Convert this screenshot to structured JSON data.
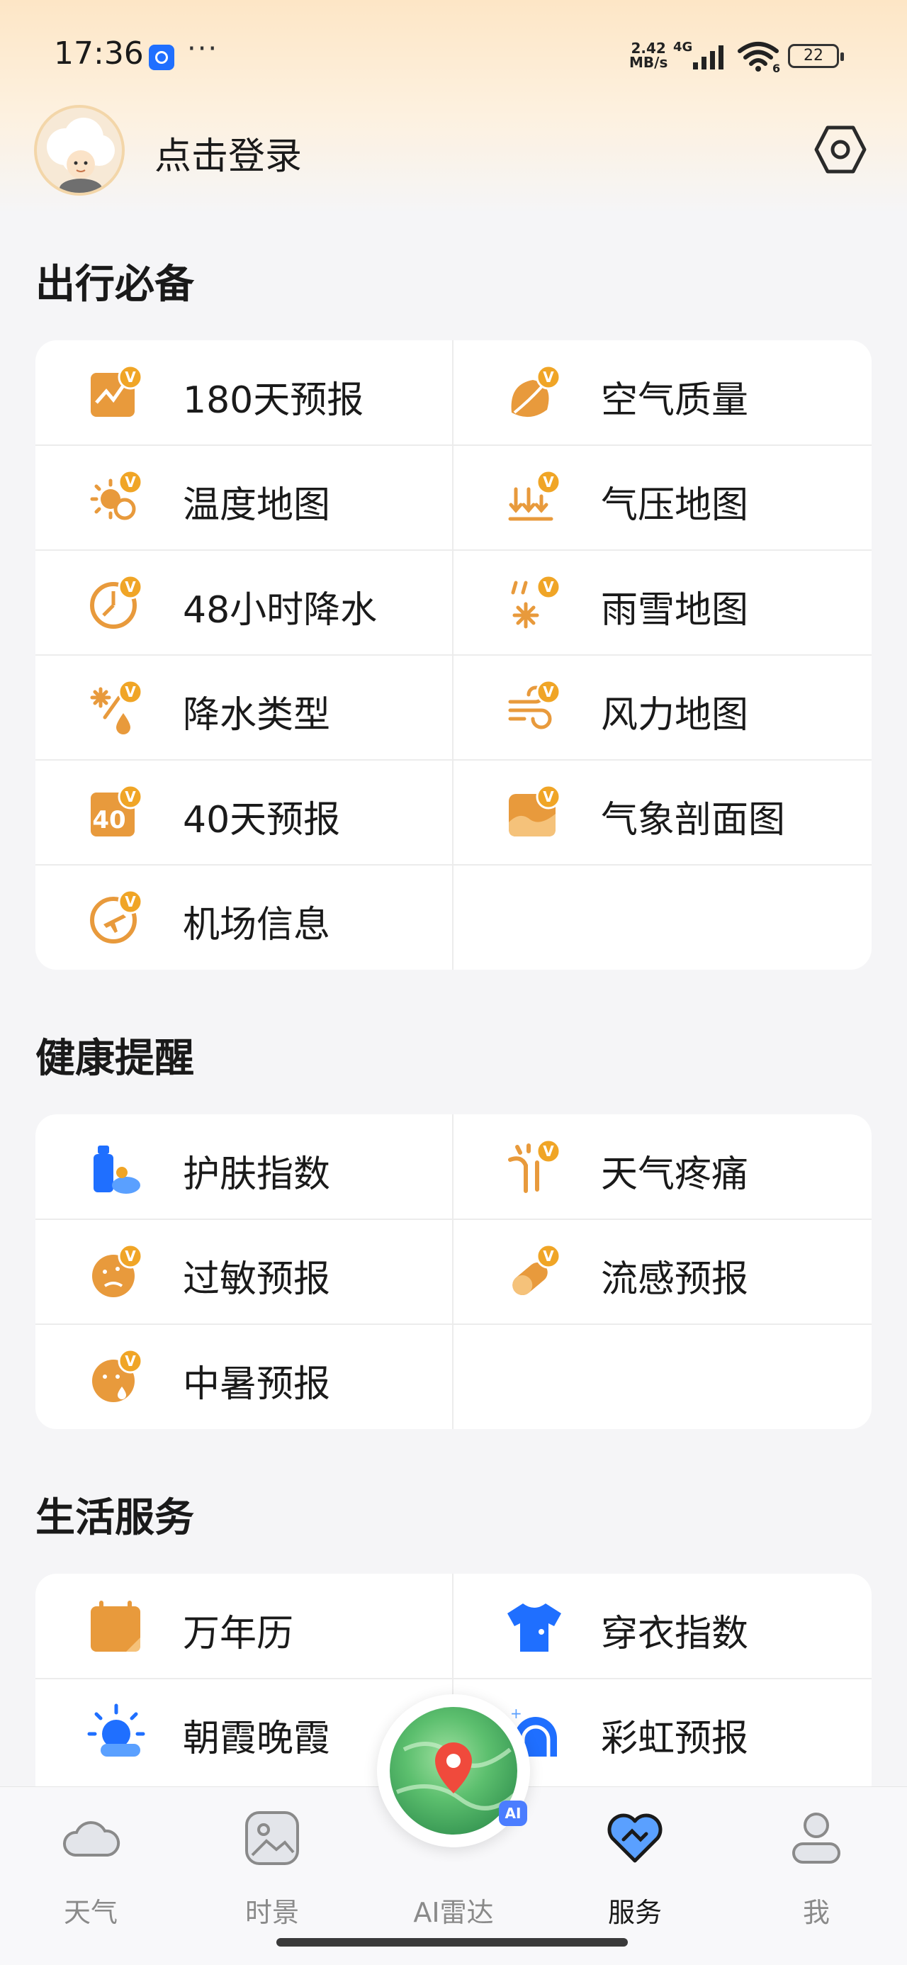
{
  "status_bar": {
    "time": "17:36",
    "speed_value": "2.42",
    "speed_unit": "MB/s",
    "network": "4G",
    "wifi_badge": "6",
    "battery": "22"
  },
  "header": {
    "login_text": "点击登录",
    "avatar_icon": "cloud-character-avatar",
    "settings_icon": "hexagon-gear-icon"
  },
  "sections": {
    "travel": {
      "title": "出行必备",
      "items": [
        {
          "label": "180天预报",
          "icon": "calendar-180-icon"
        },
        {
          "label": "空气质量",
          "icon": "leaf-icon"
        },
        {
          "label": "温度地图",
          "icon": "thermo-sun-icon"
        },
        {
          "label": "气压地图",
          "icon": "pressure-arrows-icon"
        },
        {
          "label": "48小时降水",
          "icon": "clock-rain-icon"
        },
        {
          "label": "雨雪地图",
          "icon": "rain-snow-icon"
        },
        {
          "label": "降水类型",
          "icon": "precip-type-icon"
        },
        {
          "label": "风力地图",
          "icon": "wind-icon"
        },
        {
          "label": "40天预报",
          "icon": "calendar-40-icon"
        },
        {
          "label": "气象剖面图",
          "icon": "profile-chart-icon"
        },
        {
          "label": "机场信息",
          "icon": "airplane-icon"
        }
      ]
    },
    "health": {
      "title": "健康提醒",
      "items": [
        {
          "label": "护肤指数",
          "icon": "skincare-icon"
        },
        {
          "label": "天气疼痛",
          "icon": "pain-joint-icon"
        },
        {
          "label": "过敏预报",
          "icon": "allergy-icon"
        },
        {
          "label": "流感预报",
          "icon": "pill-icon"
        },
        {
          "label": "中暑预报",
          "icon": "heatstroke-icon"
        }
      ]
    },
    "life": {
      "title": "生活服务",
      "items": [
        {
          "label": "万年历",
          "icon": "calendar-icon"
        },
        {
          "label": "穿衣指数",
          "icon": "tshirt-icon"
        },
        {
          "label": "朝霞晚霞",
          "icon": "sunrise-icon"
        },
        {
          "label": "彩虹预报",
          "icon": "rainbow-icon"
        }
      ]
    }
  },
  "bottom_nav": {
    "items": [
      {
        "label": "天气",
        "icon": "cloud-icon"
      },
      {
        "label": "时景",
        "icon": "picture-icon"
      },
      {
        "label": "AI雷达",
        "icon": "radar-map-pin-icon"
      },
      {
        "label": "服务",
        "icon": "heart-handshake-icon"
      },
      {
        "label": "我",
        "icon": "person-icon"
      }
    ],
    "active": "服务"
  },
  "colors": {
    "accent_orange": "#e89a3c",
    "vip_badge": "#f0a526",
    "brand_blue": "#1f6fff",
    "header_gradient": "#fde6c6"
  },
  "vip_badge_text": "V",
  "ai_badge_text": "AI"
}
